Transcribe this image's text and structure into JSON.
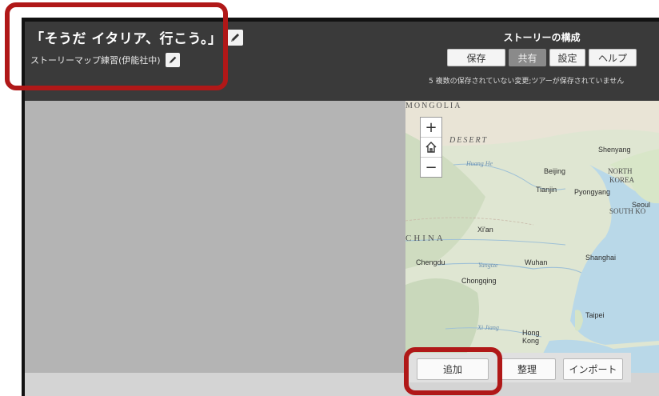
{
  "story": {
    "title": "「そうだ イタリア、行こう。」",
    "subtitle": "ストーリーマップ練習(伊能社中)"
  },
  "builder": {
    "label": "ストーリーの構成",
    "buttons": {
      "save": "保存",
      "share": "共有",
      "settings": "設定",
      "help": "ヘルプ"
    },
    "status": "5 複数の保存されていない変更;ツアーが保存されていません"
  },
  "map": {
    "zoom_in": "+",
    "zoom_out": "−",
    "labels": {
      "mongolia": "MONGOLIA",
      "desert": "DESERT",
      "huang_he": "Huang He",
      "shenyang": "Shenyang",
      "beijing": "Beijing",
      "north_korea_1": "NORTH",
      "north_korea_2": "KOREA",
      "tianjin": "Tianjin",
      "pyongyang": "Pyongyang",
      "seoul": "Seoul",
      "south_korea": "SOUTH KO",
      "xian": "Xi'an",
      "china": "CHINA",
      "chengdu": "Chengdu",
      "yangtze": "Yangtze",
      "wuhan": "Wuhan",
      "shanghai": "Shanghai",
      "chongqing": "Chongqing",
      "taipei": "Taipei",
      "xi_jiang": "Xi Jiang",
      "hong_kong_1": "Hong",
      "hong_kong_2": "Kong"
    }
  },
  "organizer": {
    "add": "追加",
    "organize": "整理",
    "import": "インポート"
  },
  "colors": {
    "header": "#3a3a3a",
    "highlight": "#b01818",
    "panel": "#b4b4b4"
  }
}
